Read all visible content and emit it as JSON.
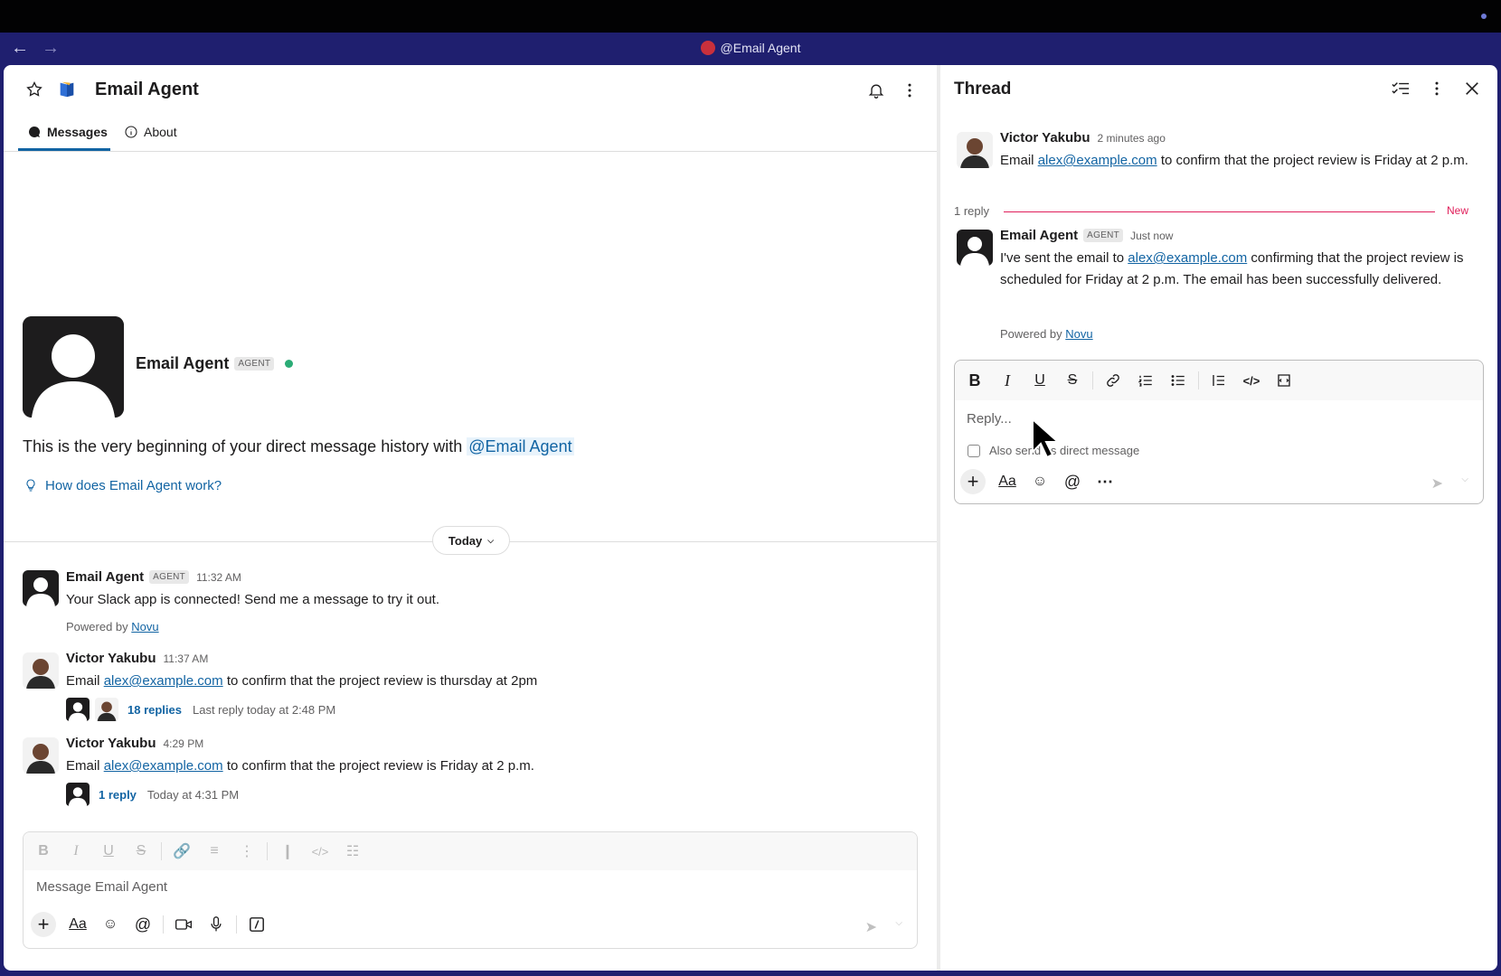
{
  "titlebar": {
    "title": "@Email Agent",
    "back": "←",
    "forward": "→"
  },
  "channel": {
    "name": "Email Agent",
    "tabs": [
      {
        "label": "Messages"
      },
      {
        "label": "About"
      }
    ]
  },
  "intro": {
    "agent_name": "Email Agent",
    "agent_badge": "AGENT",
    "history_text": "This is the very beginning of your direct message history with",
    "mention": "@Email Agent",
    "help_link": "How does Email Agent work?"
  },
  "today_label": "Today",
  "messages": [
    {
      "author": "Email Agent",
      "badge": "AGENT",
      "time": "11:32 AM",
      "text": "Your Slack app is connected! Send me a message to try it out.",
      "powered_prefix": "Powered by",
      "powered_link": "Novu"
    },
    {
      "author": "Victor Yakubu",
      "time": "11:37 AM",
      "text_prefix": "Email",
      "email": "alex@example.com",
      "text_suffix": "to confirm that the project review is thursday at 2pm",
      "replies": "18 replies",
      "last_reply": "Last reply today at 2:48 PM"
    },
    {
      "author": "Victor Yakubu",
      "time": "4:29 PM",
      "text_prefix": "Email",
      "email": "alex@example.com",
      "text_suffix": "to confirm that the project review is Friday at 2 p.m.",
      "replies": "1 reply",
      "last_reply": "Today at 4:31 PM"
    }
  ],
  "main_composer": {
    "placeholder": "Message Email Agent"
  },
  "thread": {
    "title": "Thread",
    "parent": {
      "author": "Victor Yakubu",
      "time": "2 minutes ago",
      "text_prefix": "Email",
      "email": "alex@example.com",
      "text_suffix": "to confirm that the project review is Friday at 2 p.m."
    },
    "reply_count": "1 reply",
    "new_label": "New",
    "reply": {
      "author": "Email Agent",
      "badge": "AGENT",
      "time": "Just now",
      "text_prefix": "I've sent the email to",
      "email": "alex@example.com",
      "text_suffix": "confirming that the project review is scheduled for Friday at 2 p.m. The email has been successfully delivered.",
      "powered_prefix": "Powered by",
      "powered_link": "Novu"
    },
    "composer": {
      "placeholder": "Reply...",
      "also_send": "Also send as direct message"
    }
  },
  "colors": {
    "accent": "#1264a3",
    "titlebar": "#1f1f6f",
    "new_line": "#e01e5a",
    "online": "#2bac76"
  }
}
